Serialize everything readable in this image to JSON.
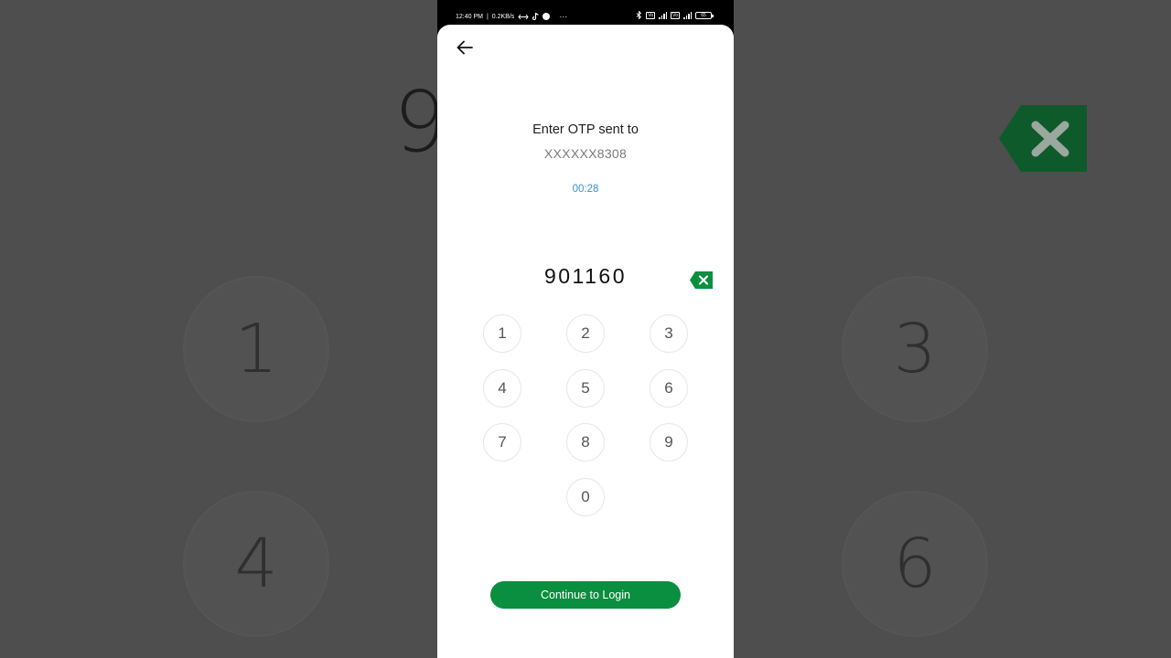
{
  "status_bar": {
    "time": "12:40 PM",
    "speed": "0.2KB/s",
    "more": "···",
    "volte_1": "Vo",
    "volte_2": "Vo",
    "battery": "65"
  },
  "otp_screen": {
    "title": "Enter OTP sent to",
    "phone_masked": "XXXXXX8308",
    "timer": "00:28",
    "otp_value": "901160"
  },
  "keypad": {
    "keys": [
      "1",
      "2",
      "3",
      "4",
      "5",
      "6",
      "7",
      "8",
      "9",
      "0"
    ]
  },
  "actions": {
    "continue_label": "Continue to Login"
  },
  "background": {
    "digit": "9",
    "keys": [
      "1",
      "3",
      "4",
      "6"
    ]
  },
  "colors": {
    "accent_green": "#0a8e3f",
    "timer_blue": "#3b94c4",
    "backspace_green": "#0a8e3f"
  }
}
